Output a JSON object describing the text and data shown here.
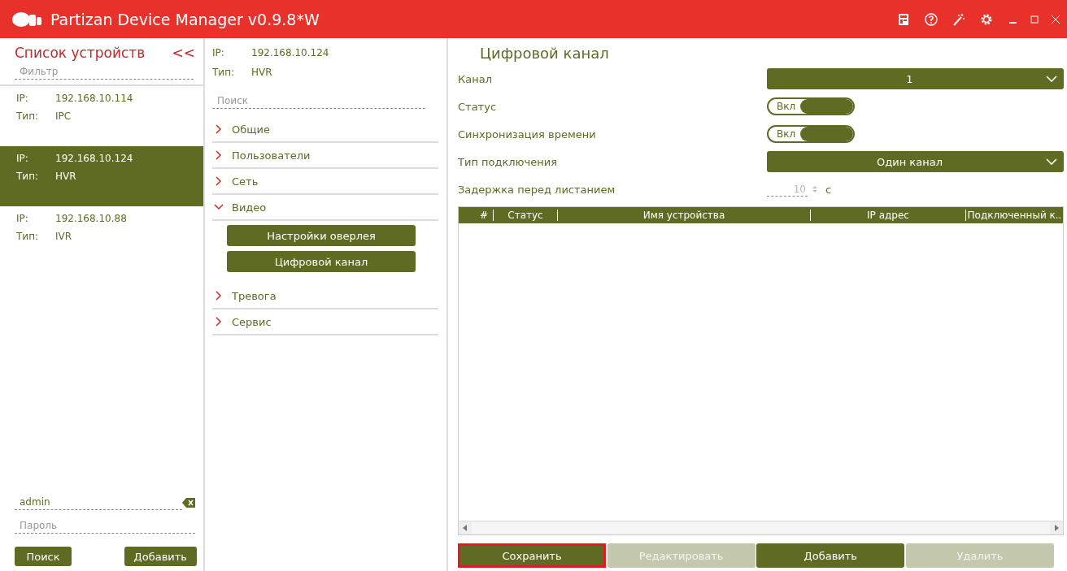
{
  "window": {
    "title": "Partizan Device Manager v0.9.8*W"
  },
  "sidebar": {
    "title": "Список устройств",
    "collapse": "<<",
    "filter": {
      "placeholder": "Фильтр"
    },
    "devices": [
      {
        "ip_label": "IP:",
        "ip": "192.168.10.114",
        "type_label": "Тип:",
        "type": "IPC",
        "selected": false
      },
      {
        "ip_label": "IP:",
        "ip": "192.168.10.124",
        "type_label": "Тип:",
        "type": "HVR",
        "selected": true
      },
      {
        "ip_label": "IP:",
        "ip": "192.168.10.88",
        "type_label": "Тип:",
        "type": "IVR",
        "selected": false
      }
    ],
    "login": {
      "value": "admin"
    },
    "password": {
      "placeholder": "Пароль"
    },
    "buttons": [
      "Поиск",
      "Добавить"
    ]
  },
  "device_info": {
    "ip_label": "IP:",
    "ip": "192.168.10.124",
    "type_label": "Тип:",
    "type": "HVR"
  },
  "menu": {
    "search": {
      "placeholder": "Поиск"
    },
    "sections": [
      {
        "label": "Общие",
        "expanded": false
      },
      {
        "label": "Пользователи",
        "expanded": false
      },
      {
        "label": "Сеть",
        "expanded": false
      },
      {
        "label": "Видео",
        "expanded": true,
        "children": [
          "Настройки оверлея",
          "Цифровой канал"
        ]
      },
      {
        "label": "Тревога",
        "expanded": false
      },
      {
        "label": "Сервис",
        "expanded": false
      }
    ]
  },
  "panel": {
    "title": "Цифровой канал",
    "fields": [
      {
        "kind": "dropdown",
        "label": "Канал",
        "value": "1"
      },
      {
        "kind": "toggle",
        "label": "Статус",
        "text": "Вкл",
        "on": true
      },
      {
        "kind": "toggle",
        "label": "Синхронизация времени",
        "text": "Вкл",
        "on": true
      },
      {
        "kind": "dropdown",
        "label": "Тип подключения",
        "value": "Один канал"
      },
      {
        "kind": "spinbox",
        "label": "Задержка перед листанием",
        "value": "10",
        "unit": "с",
        "disabled": true
      }
    ],
    "table": {
      "columns": [
        "#",
        "Статус",
        "Имя устройства",
        "IP адрес",
        "Подключенный к.."
      ]
    },
    "buttons": [
      {
        "label": "Сохранить",
        "disabled": false,
        "highlighted": true
      },
      {
        "label": "Редактировать",
        "disabled": true,
        "highlighted": false
      },
      {
        "label": "Добавить",
        "disabled": false,
        "highlighted": false
      },
      {
        "label": "Удалить",
        "disabled": true,
        "highlighted": false
      }
    ]
  }
}
